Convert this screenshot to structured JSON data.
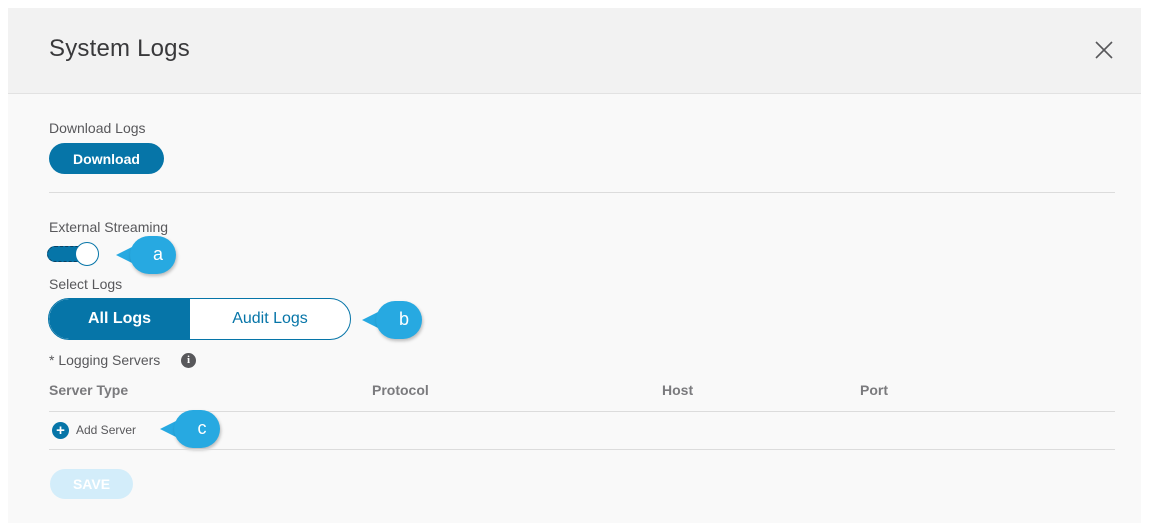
{
  "dialog": {
    "title": "System Logs",
    "close_icon": "close-icon"
  },
  "download": {
    "label": "Download Logs",
    "button": "Download"
  },
  "streaming": {
    "label": "External Streaming",
    "toggle_on": true
  },
  "select_logs": {
    "label": "Select Logs",
    "options": [
      "All Logs",
      "Audit Logs"
    ],
    "selected": "All Logs"
  },
  "logging_servers": {
    "label": "* Logging Servers",
    "info_icon": "info-icon",
    "columns": [
      "Server Type",
      "Protocol",
      "Host",
      "Port"
    ],
    "add_label": "Add Server",
    "add_icon": "plus-circle-icon"
  },
  "save": {
    "label": "SAVE"
  },
  "callouts": [
    "a",
    "b",
    "c"
  ],
  "colors": {
    "primary": "#0675a8",
    "callout": "#27a9e1",
    "save_disabled": "#d3edfa"
  }
}
